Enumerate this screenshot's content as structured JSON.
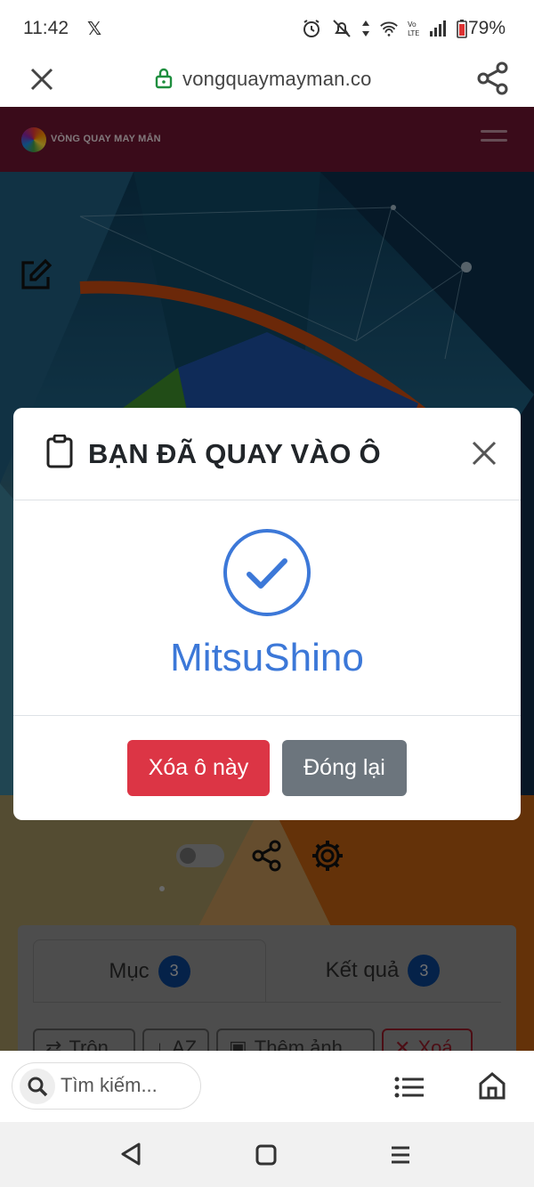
{
  "status_bar": {
    "time": "11:42",
    "social_glyph": "𝕏",
    "battery": "79%",
    "icons": [
      "alarm-icon",
      "muted-icon",
      "data-arrows-icon",
      "wifi-icon",
      "volte-icon",
      "signal-icon",
      "battery-icon"
    ]
  },
  "browser": {
    "url": "vongquaymayman.co",
    "close_icon": "close-icon",
    "share_icon": "share-icon",
    "lock_color": "#1e8e3e"
  },
  "site": {
    "name": "VÒNG QUAY MAY MẮN",
    "header_color": "#6b1530"
  },
  "panel": {
    "tabs": [
      {
        "label": "Mục",
        "count": "3"
      },
      {
        "label": "Kết quả",
        "count": "3"
      }
    ],
    "buttons": [
      "Trộn",
      "AZ",
      "Thêm ảnh",
      "Xoá"
    ]
  },
  "modal": {
    "title": "BẠN ĐÃ QUAY VÀO Ô",
    "result": "MitsuShino",
    "delete_label": "Xóa ô này",
    "close_label": "Đóng lại",
    "accent": "#3c78d8",
    "danger": "#dc3545",
    "secondary": "#6c757d"
  },
  "bottom_bar": {
    "search_placeholder": "Tìm kiếm..."
  },
  "nav_bar": {
    "icons": [
      "back-icon",
      "home-square-icon",
      "recents-menu-icon"
    ]
  }
}
